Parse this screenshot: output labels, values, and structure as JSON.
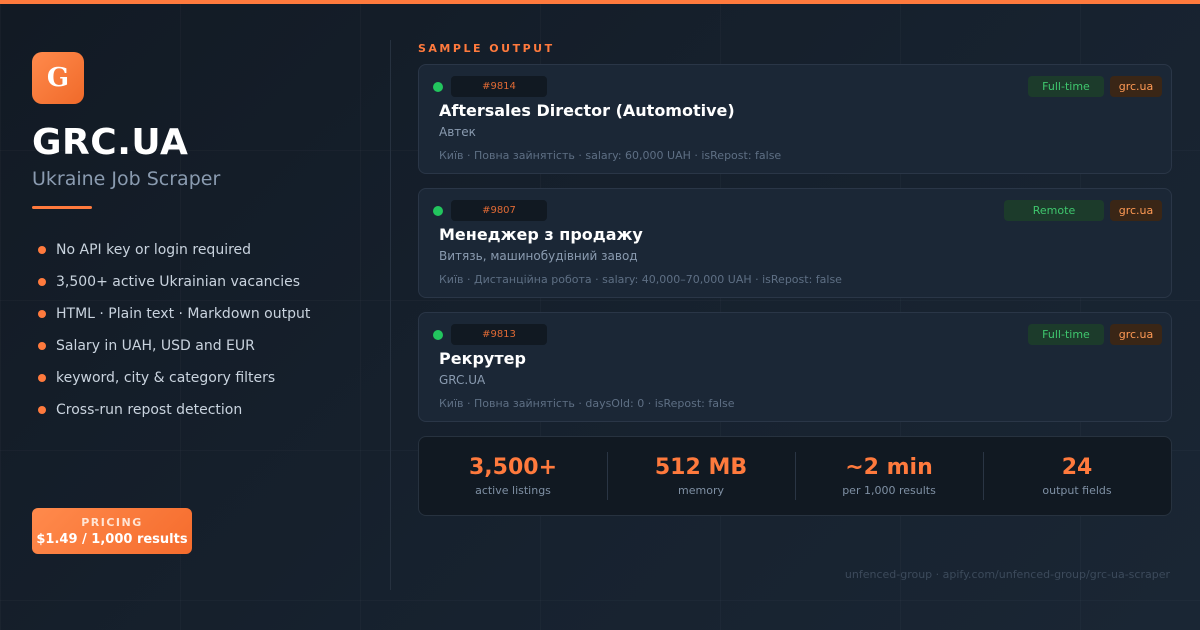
{
  "logo": {
    "letter": "G"
  },
  "brand": {
    "title": "GRC.UA",
    "subtitle": "Ukraine Job Scraper",
    "accent_color": "#ff7a3d"
  },
  "features": [
    "No API key or login required",
    "3,500+ active Ukrainian vacancies",
    "HTML · Plain text · Markdown output",
    "Salary in UAH, USD and EUR",
    "keyword, city & category filters",
    "Cross-run repost detection"
  ],
  "pricing": {
    "label": "PRICING",
    "value": "$1.49 / 1,000 results"
  },
  "sample": {
    "label": "SAMPLE OUTPUT",
    "cards": [
      {
        "id": "#9814",
        "type": "Full-time",
        "source": "grc.ua",
        "title": "Aftersales Director (Automotive)",
        "company": "Автек",
        "meta": "Київ · Повна зайнятість · salary: 60,000 UAH · isRepost: false"
      },
      {
        "id": "#9807",
        "type": "Remote",
        "source": "grc.ua",
        "title": "Менеджер з продажу",
        "company": "Витязь, машинобудівний завод",
        "meta": "Київ · Дистанційна робота · salary: 40,000–70,000 UAH · isRepost: false"
      },
      {
        "id": "#9813",
        "type": "Full-time",
        "source": "grc.ua",
        "title": "Рекрутер",
        "company": "GRC.UA",
        "meta": "Київ · Повна зайнятість · daysOld: 0 · isRepost: false"
      }
    ]
  },
  "stats": [
    {
      "value": "3,500+",
      "label": "active listings"
    },
    {
      "value": "512 MB",
      "label": "memory"
    },
    {
      "value": "~2 min",
      "label": "per 1,000 results"
    },
    {
      "value": "24",
      "label": "output fields"
    }
  ],
  "footer": {
    "text": "unfenced-group · apify.com/unfenced-group/grc-ua-scraper"
  }
}
